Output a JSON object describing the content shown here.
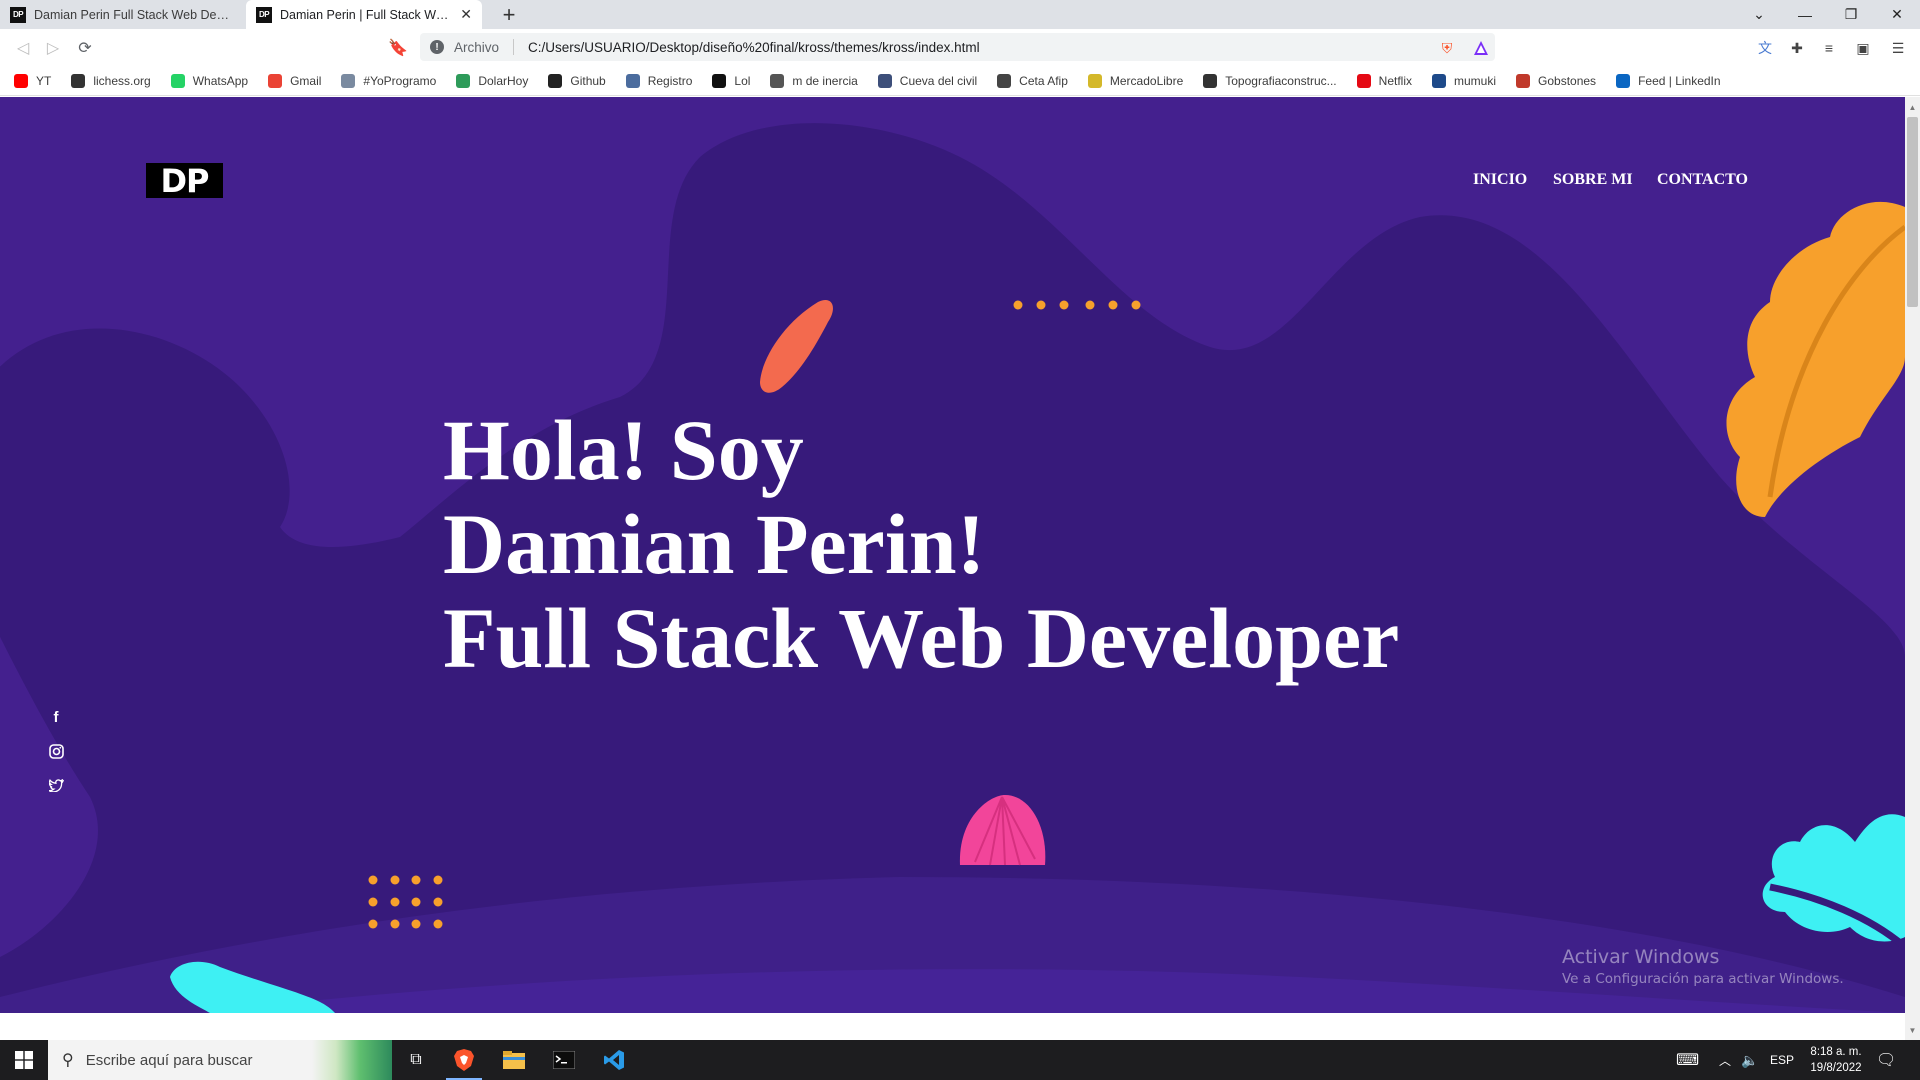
{
  "browser": {
    "tabs": [
      {
        "title": "Damian Perin Full Stack Web Developer",
        "active": false
      },
      {
        "title": "Damian Perin | Full Stack Web Developer",
        "active": true
      }
    ],
    "favicon_text": "DP",
    "address": {
      "scheme_label": "Archivo",
      "url": "C:/Users/USUARIO/Desktop/dise%C3%B1o%20final/kross/themes/kross/index.html",
      "url_display": "C:/Users/USUARIO/Desktop/diseño%20final/kross/themes/kross/index.html"
    },
    "bookmarks": [
      {
        "label": "YT",
        "icon": "youtube-icon",
        "color": "#ff0000"
      },
      {
        "label": "lichess.org",
        "icon": "lichess-icon",
        "color": "#333333"
      },
      {
        "label": "WhatsApp",
        "icon": "whatsapp-icon",
        "color": "#25d366"
      },
      {
        "label": "Gmail",
        "icon": "gmail-icon",
        "color": "#ea4335"
      },
      {
        "label": "#YoProgramo",
        "icon": "yoprogramo-icon",
        "color": "#7a8aa0"
      },
      {
        "label": "DolarHoy",
        "icon": "dolarhoy-icon",
        "color": "#2e9b5a"
      },
      {
        "label": "Github",
        "icon": "github-icon",
        "color": "#222222"
      },
      {
        "label": "Registro",
        "icon": "registro-icon",
        "color": "#4b6c9e"
      },
      {
        "label": "Lol",
        "icon": "lol-icon",
        "color": "#111111"
      },
      {
        "label": "m de inercia",
        "icon": "wikipedia-icon",
        "color": "#555555"
      },
      {
        "label": "Cueva del civil",
        "icon": "cueva-icon",
        "color": "#3d4f7a"
      },
      {
        "label": "Ceta Afip",
        "icon": "afip-icon",
        "color": "#444444"
      },
      {
        "label": "MercadoLibre",
        "icon": "mercadolibre-icon",
        "color": "#d4b82a"
      },
      {
        "label": "Topografiaconstruc...",
        "icon": "topografia-icon",
        "color": "#333333"
      },
      {
        "label": "Netflix",
        "icon": "netflix-icon",
        "color": "#e50914"
      },
      {
        "label": "mumuki",
        "icon": "mumuki-icon",
        "color": "#1e4a8a"
      },
      {
        "label": "Gobstones",
        "icon": "gobstones-icon",
        "color": "#c0392b"
      },
      {
        "label": "Feed | LinkedIn",
        "icon": "linkedin-icon",
        "color": "#0a66c2"
      }
    ]
  },
  "site": {
    "logo": "DP",
    "nav": [
      {
        "label": "INICIO"
      },
      {
        "label": "SOBRE MI"
      },
      {
        "label": "CONTACTO"
      }
    ],
    "hero_lines": [
      "Hola! Soy",
      "Damian Perin!",
      "Full Stack Web Developer"
    ],
    "social": [
      {
        "icon": "facebook-icon",
        "glyph": "f"
      },
      {
        "icon": "instagram-icon",
        "glyph": "◎"
      },
      {
        "icon": "twitter-icon",
        "glyph": "🐦"
      }
    ],
    "colors": {
      "background": "#44208e",
      "blob": "#371a7b",
      "orange": "#f7a02c",
      "coral": "#f36a4e",
      "pink": "#f2459a",
      "cyan": "#3ef0f3"
    }
  },
  "watermark": {
    "title": "Activar Windows",
    "subtitle": "Ve a Configuración para activar Windows."
  },
  "taskbar": {
    "search_placeholder": "Escribe aquí para buscar",
    "language": "ESP",
    "time": "8:18 a. m.",
    "date": "19/8/2022"
  }
}
